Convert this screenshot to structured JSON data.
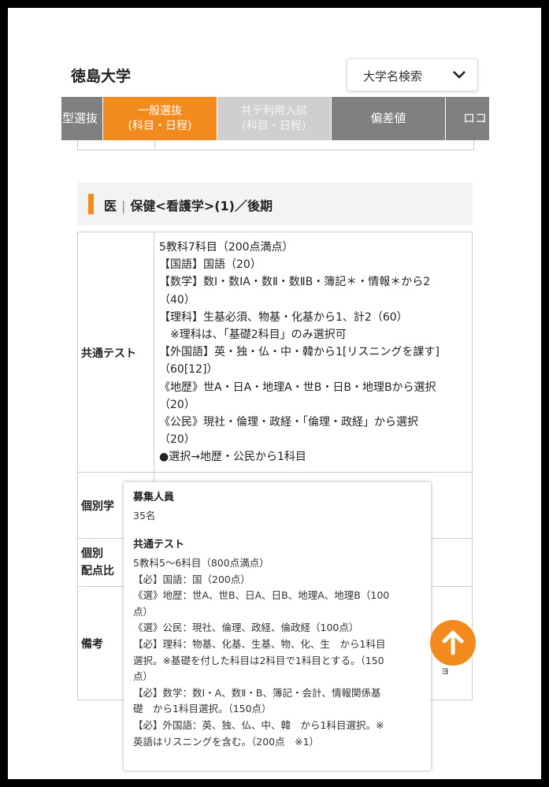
{
  "header": {
    "title": "徳島大学",
    "search_label": "大学名検索"
  },
  "tabs": [
    {
      "line1": "型選抜",
      "line2": ""
    },
    {
      "line1": "一般選抜",
      "line2": "(科目・日程)"
    },
    {
      "line1": "共テ利用入試",
      "line2": "(科目・日程)"
    },
    {
      "line1": "偏差値",
      "line2": ""
    },
    {
      "line1": "ロコ",
      "line2": ""
    }
  ],
  "section": {
    "dept": "医",
    "course": "保健<看護学>(1)／後期"
  },
  "table": {
    "row1_label": "共通テスト",
    "row1_lines": [
      "5教科7科目（200点満点）",
      "【国語】国語（20）",
      "【数学】数Ⅰ・数ⅠA・数Ⅱ・数ⅡB・簿記＊・情報＊から2",
      "（40）",
      "【理科】生基必須、物基・化基から1、計2（60）",
      "※理科は、「基礎2科目」のみ選択可",
      "【外国語】英・独・仏・中・韓から1[リスニングを課す]",
      "（60[12]）",
      "《地歴》世A・日A・地理A・世B・日B・地理Bから選択",
      "（20）",
      "《公民》現社・倫理・政経・「倫理・政経」から選択",
      "（20）",
      "●選択→地歴・公民から1科目"
    ],
    "row2_label": "個別学",
    "row3_label_1": "個別",
    "row3_label_2": "配点比",
    "row4_label": "備考"
  },
  "popup": {
    "h1": "募集人員",
    "capacity": "35名",
    "h2": "共通テスト",
    "lines": [
      "5教科5〜6科目（800点満点）",
      "【必】国語：国（200点）",
      "《選》地歴：世A、世B、日A、日B、地理A、地理B（100",
      "点）",
      "《選》公民：現社、倫理、政経、倫政経（100点）",
      "【必】理科：物基、化基、生基、物、化、生　から1科目",
      "選択。※基礎を付した科目は2科目で1科目とする。（150",
      "点）",
      "【必】数学：数Ⅰ・A、数Ⅱ・B、簿記・会計、情報関係基",
      "礎　から1科目選択。（150点）",
      "【必】外国語：英、独、仏、中、韓　から1科目選択。※",
      "英語はリスニングを含む。（200点　※1）"
    ]
  },
  "tail_char": "ョ",
  "colors": {
    "accent": "#f28a1d",
    "tab_gray": "#808080",
    "tab_disabled": "#cfcfcf"
  },
  "icons": {
    "search_chevron": "chevron-down-icon",
    "scroll_top": "arrow-up-icon"
  }
}
